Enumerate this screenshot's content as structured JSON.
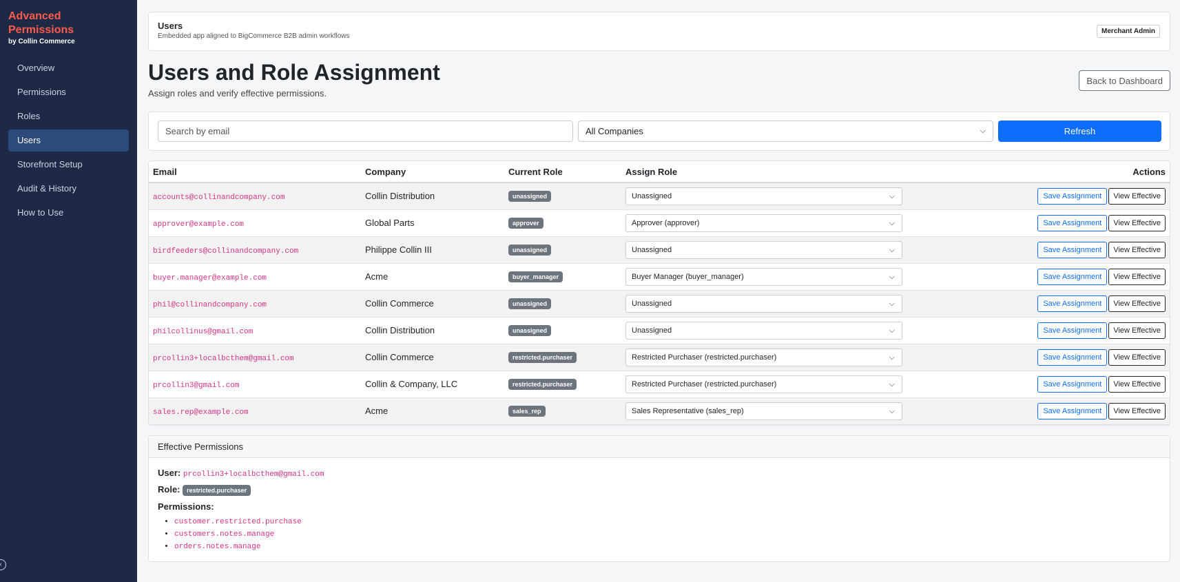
{
  "sidebar": {
    "brand_title": "Advanced Permissions",
    "brand_sub": "by Collin Commerce",
    "items": [
      {
        "label": "Overview"
      },
      {
        "label": "Permissions"
      },
      {
        "label": "Roles"
      },
      {
        "label": "Users",
        "active": true
      },
      {
        "label": "Storefront Setup"
      },
      {
        "label": "Audit & History"
      },
      {
        "label": "How to Use"
      }
    ],
    "collapse_icon": "chevron-left-icon"
  },
  "topbar": {
    "title": "Users",
    "subtitle": "Embedded app aligned to BigCommerce B2B admin workflows",
    "role_badge": "Merchant Admin"
  },
  "page": {
    "title": "Users and Role Assignment",
    "subtitle": "Assign roles and verify effective permissions.",
    "back_button": "Back to Dashboard"
  },
  "filters": {
    "search_placeholder": "Search by email",
    "company_value": "All Companies",
    "refresh_label": "Refresh"
  },
  "table": {
    "headers": {
      "email": "Email",
      "company": "Company",
      "current_role": "Current Role",
      "assign_role": "Assign Role",
      "actions": "Actions"
    },
    "save_label": "Save Assignment",
    "view_label": "View Effective",
    "rows": [
      {
        "email": "accounts@collinandcompany.com",
        "company": "Collin Distribution",
        "role": "unassigned",
        "assign": "Unassigned"
      },
      {
        "email": "approver@example.com",
        "company": "Global Parts",
        "role": "approver",
        "assign": "Approver (approver)"
      },
      {
        "email": "birdfeeders@collinandcompany.com",
        "company": "Philippe Collin III",
        "role": "unassigned",
        "assign": "Unassigned"
      },
      {
        "email": "buyer.manager@example.com",
        "company": "Acme",
        "role": "buyer_manager",
        "assign": "Buyer Manager (buyer_manager)"
      },
      {
        "email": "phil@collinandcompany.com",
        "company": "Collin Commerce",
        "role": "unassigned",
        "assign": "Unassigned"
      },
      {
        "email": "philcollinus@gmail.com",
        "company": "Collin Distribution",
        "role": "unassigned",
        "assign": "Unassigned"
      },
      {
        "email": "prcollin3+localbcthem@gmail.com",
        "company": "Collin Commerce",
        "role": "restricted.purchaser",
        "assign": "Restricted Purchaser (restricted.purchaser)"
      },
      {
        "email": "prcollin3@gmail.com",
        "company": "Collin & Company, LLC",
        "role": "restricted.purchaser",
        "assign": "Restricted Purchaser (restricted.purchaser)"
      },
      {
        "email": "sales.rep@example.com",
        "company": "Acme",
        "role": "sales_rep",
        "assign": "Sales Representative (sales_rep)"
      }
    ]
  },
  "effective": {
    "header": "Effective Permissions",
    "user_label": "User:",
    "user_value": "prcollin3+localbcthem@gmail.com",
    "role_label": "Role:",
    "role_value": "restricted.purchaser",
    "permissions_label": "Permissions:",
    "permissions": [
      "customer.restricted.purchase",
      "customers.notes.manage",
      "orders.notes.manage"
    ]
  },
  "colors": {
    "sidebar_bg": "#1e2a45",
    "brand": "#ff5a4e",
    "primary": "#0d6efd",
    "code": "#d63384",
    "badge": "#6c757d"
  }
}
